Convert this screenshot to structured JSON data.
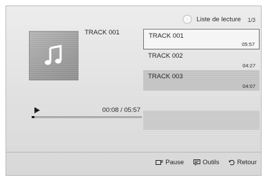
{
  "header": {
    "playlist_label": "Liste de lecture",
    "page_indicator": "1/3"
  },
  "now_playing": {
    "title": "TRACK 001",
    "time": "00:08 / 05:57",
    "progress": 0.022
  },
  "tracks": [
    {
      "title": "TRACK 001",
      "duration": "05:57",
      "state": "selected"
    },
    {
      "title": "TRACK 002",
      "duration": "04:27",
      "state": "normal"
    },
    {
      "title": "TRACK 003",
      "duration": "04:07",
      "state": "highlight"
    }
  ],
  "footer": {
    "pause_label": "Pause",
    "tools_label": "Outils",
    "back_label": "Retour"
  },
  "icons": {
    "album_art": "music-note-icon",
    "play": "play-icon",
    "playlist": "playlist-icon",
    "pause": "pause-icon",
    "tools": "tools-icon",
    "back": "return-icon"
  }
}
